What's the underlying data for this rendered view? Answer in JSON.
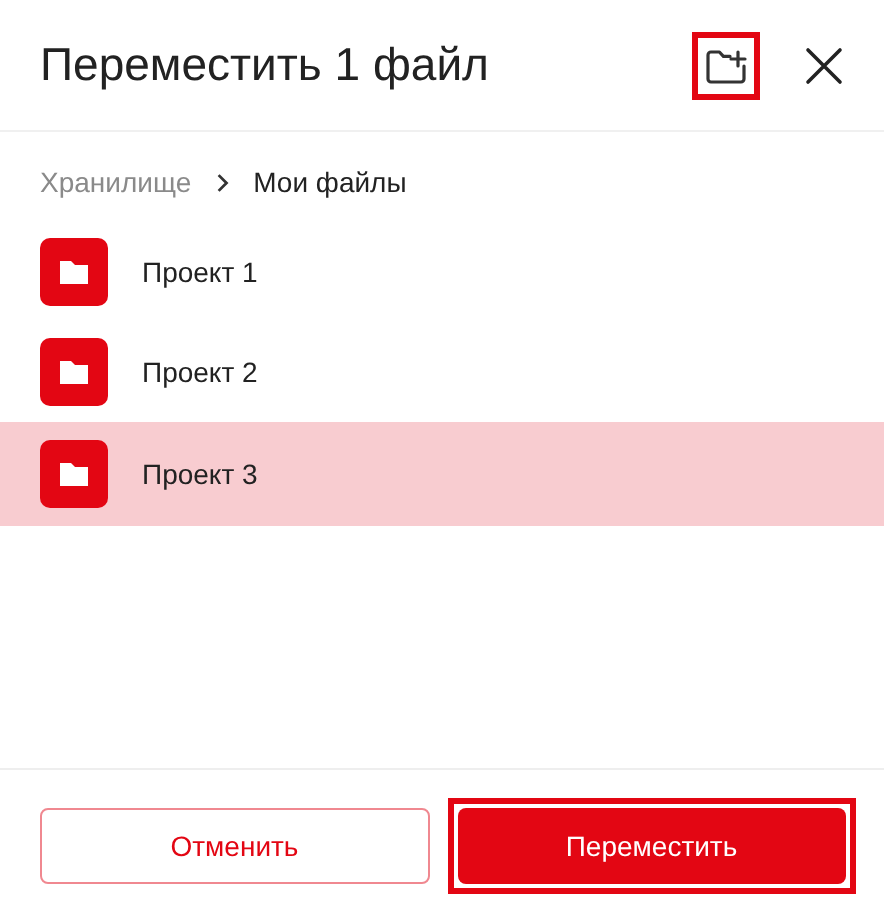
{
  "dialog": {
    "title": "Переместить 1 файл",
    "new_folder_highlighted": true
  },
  "breadcrumb": [
    {
      "label": "Хранилище",
      "current": false
    },
    {
      "label": "Мои файлы",
      "current": true
    }
  ],
  "folders": [
    {
      "name": "Проект 1",
      "selected": false
    },
    {
      "name": "Проект 2",
      "selected": false
    },
    {
      "name": "Проект 3",
      "selected": true
    }
  ],
  "buttons": [
    {
      "label": "Отменить",
      "kind": "secondary",
      "highlighted": false
    },
    {
      "label": "Переместить",
      "kind": "primary",
      "highlighted": true
    }
  ]
}
